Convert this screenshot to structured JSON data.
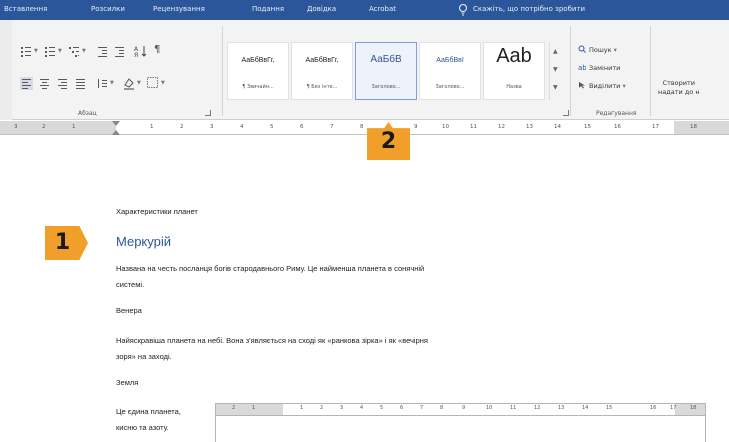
{
  "ribbon_tabs": [
    "Розсилки",
    "Рецензування",
    "Подання",
    "Довідка",
    "Acrobat"
  ],
  "ribbon_tab_first": "Вставлення",
  "tell_me": "Скажіть, що потрібно зробити",
  "paragraph_group_label": "Абзац",
  "styles": [
    {
      "sample": "АаБбВвГг,",
      "name": "¶ Звичайн..."
    },
    {
      "sample": "АаБбВвГг,",
      "name": "¶ Без інте..."
    },
    {
      "sample": "АаБбВ",
      "name": "Заголово..."
    },
    {
      "sample": "АаБбВвІ",
      "name": "Заголово..."
    },
    {
      "sample": "Aab",
      "name": "Назва"
    }
  ],
  "editing": {
    "find": "Пошук",
    "replace": "Замінити",
    "select": "Виділити",
    "group_label": "Редагування"
  },
  "create_line1": "Створити",
  "create_line2": "надати до н",
  "ruler_numbers": [
    "3",
    "2",
    "1",
    "1",
    "2",
    "3",
    "4",
    "5",
    "6",
    "7",
    "8",
    "9",
    "10",
    "11",
    "12",
    "13",
    "14",
    "15",
    "16",
    "17",
    "18"
  ],
  "document": {
    "title_line": "Характеристики планет",
    "heading": "Меркурій",
    "p1_line1": "Названа на честь посланця богів стародавнього Риму. Це найменша планета в сонячній",
    "p1_line2": "системі.",
    "venus": "Венера",
    "p2_line1": "Найяскравіша планета на небі. Вона з'являється на сході як «ранкова зірка» і як «вечірня",
    "p2_line2": "зоря» на заході.",
    "earth": "Земля",
    "p3_line1": "Це єдина планета,",
    "p3_line2": "кисню та азоту."
  },
  "callouts": {
    "one": "1",
    "two": "2"
  },
  "colors": {
    "ribbon_blue": "#2b579a",
    "heading_blue": "#2f5597",
    "callout_orange": "#f0a02a"
  }
}
